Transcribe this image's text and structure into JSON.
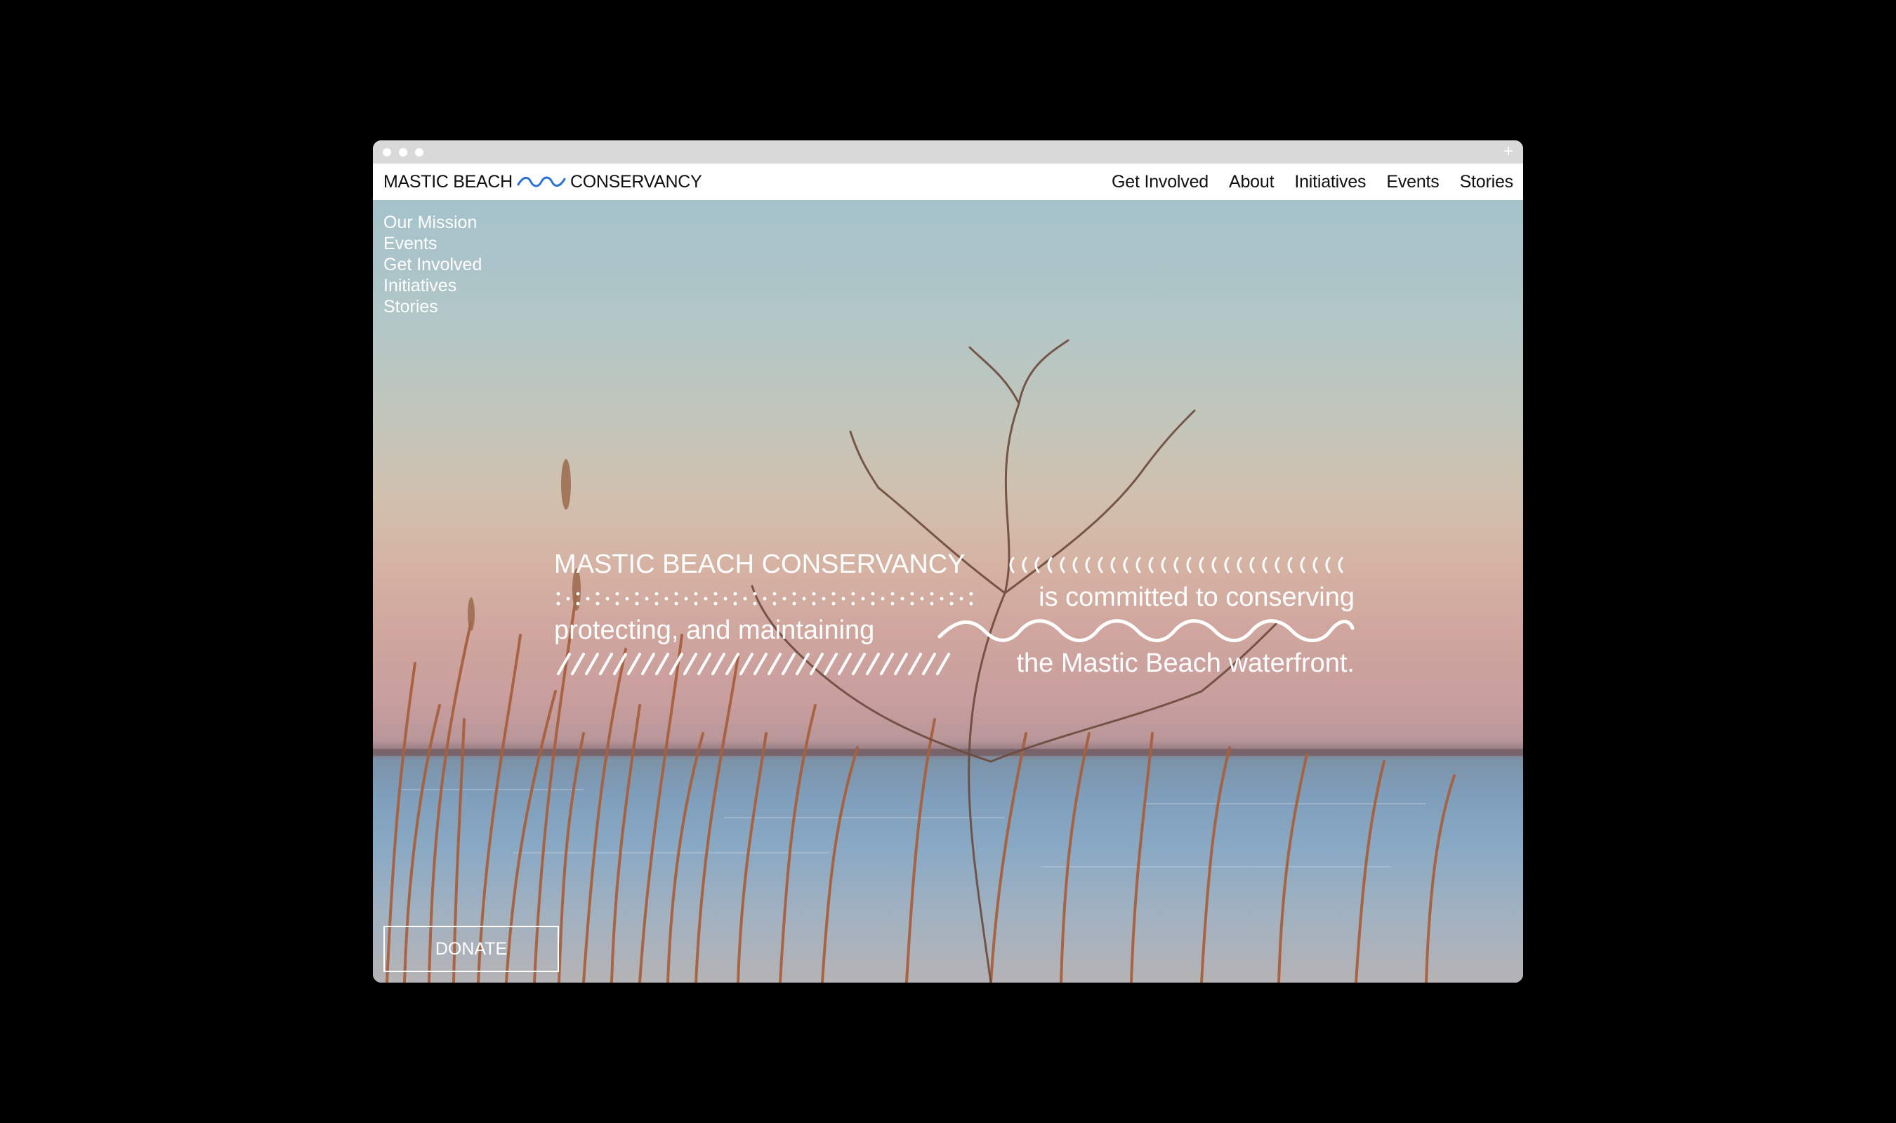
{
  "brand": {
    "left": "MASTIC BEACH",
    "right": "CONSERVANCY",
    "accent_color": "#2a6fd6"
  },
  "main_nav": [
    {
      "label": "Get Involved"
    },
    {
      "label": "About"
    },
    {
      "label": "Initiatives"
    },
    {
      "label": "Events"
    },
    {
      "label": "Stories"
    }
  ],
  "sub_nav": [
    {
      "label": "Our Mission"
    },
    {
      "label": "Events"
    },
    {
      "label": "Get Involved"
    },
    {
      "label": "Initiatives"
    },
    {
      "label": "Stories"
    }
  ],
  "hero": {
    "line1": "MASTIC BEACH CONSERVANCY",
    "line2": "is committed to conserving",
    "line3": "protecting, and maintaining",
    "line4": "the Mastic Beach waterfront."
  },
  "donate_label": "DONATE",
  "window": {
    "new_tab_icon": "+"
  }
}
